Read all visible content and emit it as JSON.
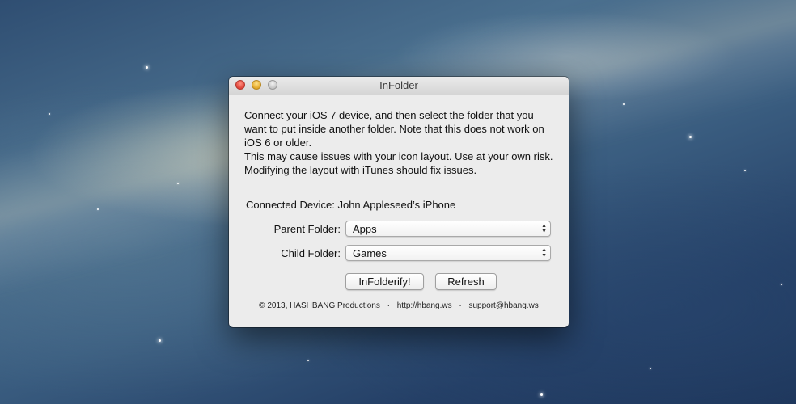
{
  "window": {
    "title": "InFolder"
  },
  "description": {
    "line1": "Connect your iOS 7 device, and then select the folder that you want to put inside another folder. Note that this does not work on iOS 6 or older.",
    "line2": "This may cause issues with your icon layout. Use at your own risk. Modifying the layout with iTunes should fix issues."
  },
  "device": {
    "label": "Connected Device:",
    "value": "John Appleseed’s iPhone"
  },
  "parent_folder": {
    "label": "Parent Folder:",
    "selected": "Apps"
  },
  "child_folder": {
    "label": "Child Folder:",
    "selected": "Games"
  },
  "buttons": {
    "infolderify": "InFolderify!",
    "refresh": "Refresh"
  },
  "footer": {
    "copyright": "© 2013, HASHBANG Productions",
    "website": "http://hbang.ws",
    "email": "support@hbang.ws",
    "separator": "·"
  }
}
